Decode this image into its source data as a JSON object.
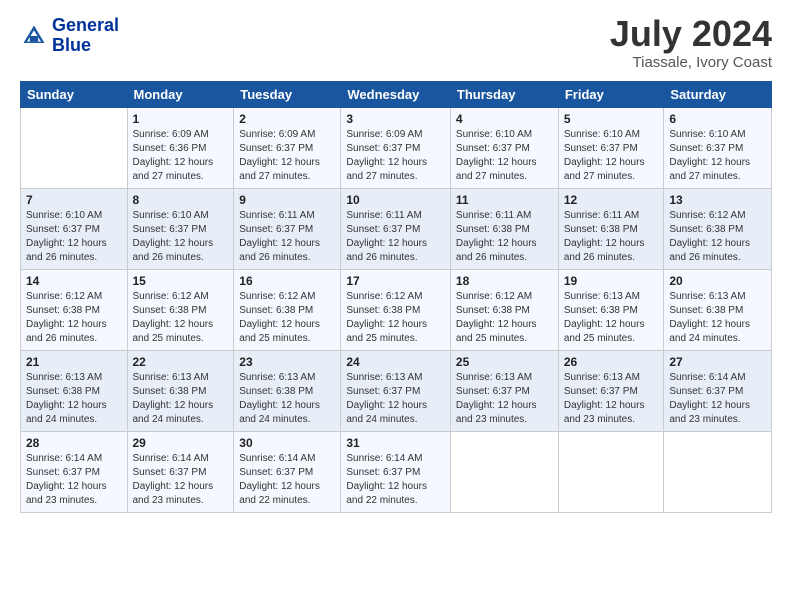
{
  "header": {
    "logo_line1": "General",
    "logo_line2": "Blue",
    "month_year": "July 2024",
    "location": "Tiassale, Ivory Coast"
  },
  "weekdays": [
    "Sunday",
    "Monday",
    "Tuesday",
    "Wednesday",
    "Thursday",
    "Friday",
    "Saturday"
  ],
  "weeks": [
    [
      {
        "day": "",
        "info": ""
      },
      {
        "day": "1",
        "info": "Sunrise: 6:09 AM\nSunset: 6:36 PM\nDaylight: 12 hours\nand 27 minutes."
      },
      {
        "day": "2",
        "info": "Sunrise: 6:09 AM\nSunset: 6:37 PM\nDaylight: 12 hours\nand 27 minutes."
      },
      {
        "day": "3",
        "info": "Sunrise: 6:09 AM\nSunset: 6:37 PM\nDaylight: 12 hours\nand 27 minutes."
      },
      {
        "day": "4",
        "info": "Sunrise: 6:10 AM\nSunset: 6:37 PM\nDaylight: 12 hours\nand 27 minutes."
      },
      {
        "day": "5",
        "info": "Sunrise: 6:10 AM\nSunset: 6:37 PM\nDaylight: 12 hours\nand 27 minutes."
      },
      {
        "day": "6",
        "info": "Sunrise: 6:10 AM\nSunset: 6:37 PM\nDaylight: 12 hours\nand 27 minutes."
      }
    ],
    [
      {
        "day": "7",
        "info": "Sunrise: 6:10 AM\nSunset: 6:37 PM\nDaylight: 12 hours\nand 26 minutes."
      },
      {
        "day": "8",
        "info": "Sunrise: 6:10 AM\nSunset: 6:37 PM\nDaylight: 12 hours\nand 26 minutes."
      },
      {
        "day": "9",
        "info": "Sunrise: 6:11 AM\nSunset: 6:37 PM\nDaylight: 12 hours\nand 26 minutes."
      },
      {
        "day": "10",
        "info": "Sunrise: 6:11 AM\nSunset: 6:37 PM\nDaylight: 12 hours\nand 26 minutes."
      },
      {
        "day": "11",
        "info": "Sunrise: 6:11 AM\nSunset: 6:38 PM\nDaylight: 12 hours\nand 26 minutes."
      },
      {
        "day": "12",
        "info": "Sunrise: 6:11 AM\nSunset: 6:38 PM\nDaylight: 12 hours\nand 26 minutes."
      },
      {
        "day": "13",
        "info": "Sunrise: 6:12 AM\nSunset: 6:38 PM\nDaylight: 12 hours\nand 26 minutes."
      }
    ],
    [
      {
        "day": "14",
        "info": "Sunrise: 6:12 AM\nSunset: 6:38 PM\nDaylight: 12 hours\nand 26 minutes."
      },
      {
        "day": "15",
        "info": "Sunrise: 6:12 AM\nSunset: 6:38 PM\nDaylight: 12 hours\nand 25 minutes."
      },
      {
        "day": "16",
        "info": "Sunrise: 6:12 AM\nSunset: 6:38 PM\nDaylight: 12 hours\nand 25 minutes."
      },
      {
        "day": "17",
        "info": "Sunrise: 6:12 AM\nSunset: 6:38 PM\nDaylight: 12 hours\nand 25 minutes."
      },
      {
        "day": "18",
        "info": "Sunrise: 6:12 AM\nSunset: 6:38 PM\nDaylight: 12 hours\nand 25 minutes."
      },
      {
        "day": "19",
        "info": "Sunrise: 6:13 AM\nSunset: 6:38 PM\nDaylight: 12 hours\nand 25 minutes."
      },
      {
        "day": "20",
        "info": "Sunrise: 6:13 AM\nSunset: 6:38 PM\nDaylight: 12 hours\nand 24 minutes."
      }
    ],
    [
      {
        "day": "21",
        "info": "Sunrise: 6:13 AM\nSunset: 6:38 PM\nDaylight: 12 hours\nand 24 minutes."
      },
      {
        "day": "22",
        "info": "Sunrise: 6:13 AM\nSunset: 6:38 PM\nDaylight: 12 hours\nand 24 minutes."
      },
      {
        "day": "23",
        "info": "Sunrise: 6:13 AM\nSunset: 6:38 PM\nDaylight: 12 hours\nand 24 minutes."
      },
      {
        "day": "24",
        "info": "Sunrise: 6:13 AM\nSunset: 6:37 PM\nDaylight: 12 hours\nand 24 minutes."
      },
      {
        "day": "25",
        "info": "Sunrise: 6:13 AM\nSunset: 6:37 PM\nDaylight: 12 hours\nand 23 minutes."
      },
      {
        "day": "26",
        "info": "Sunrise: 6:13 AM\nSunset: 6:37 PM\nDaylight: 12 hours\nand 23 minutes."
      },
      {
        "day": "27",
        "info": "Sunrise: 6:14 AM\nSunset: 6:37 PM\nDaylight: 12 hours\nand 23 minutes."
      }
    ],
    [
      {
        "day": "28",
        "info": "Sunrise: 6:14 AM\nSunset: 6:37 PM\nDaylight: 12 hours\nand 23 minutes."
      },
      {
        "day": "29",
        "info": "Sunrise: 6:14 AM\nSunset: 6:37 PM\nDaylight: 12 hours\nand 23 minutes."
      },
      {
        "day": "30",
        "info": "Sunrise: 6:14 AM\nSunset: 6:37 PM\nDaylight: 12 hours\nand 22 minutes."
      },
      {
        "day": "31",
        "info": "Sunrise: 6:14 AM\nSunset: 6:37 PM\nDaylight: 12 hours\nand 22 minutes."
      },
      {
        "day": "",
        "info": ""
      },
      {
        "day": "",
        "info": ""
      },
      {
        "day": "",
        "info": ""
      }
    ]
  ]
}
